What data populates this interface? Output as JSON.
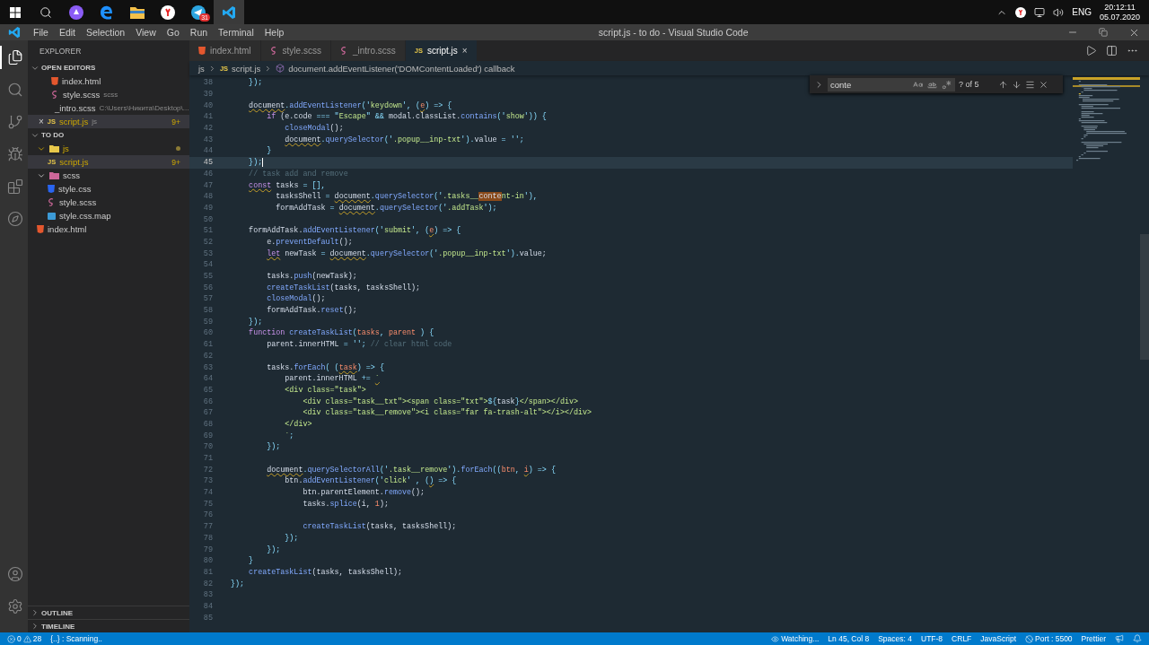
{
  "taskbar": {
    "apps": [
      {
        "kind": "start",
        "selected": false
      },
      {
        "kind": "search",
        "selected": false
      },
      {
        "kind": "assistant",
        "selected": false
      },
      {
        "kind": "edge",
        "selected": false
      },
      {
        "kind": "explorer",
        "selected": false
      },
      {
        "kind": "yandex",
        "selected": false
      },
      {
        "kind": "telegram",
        "selected": false,
        "badge": "31"
      },
      {
        "kind": "vscode",
        "selected": true
      }
    ],
    "tray": {
      "icons": [
        {
          "kind": "chevron"
        },
        {
          "kind": "yandex"
        },
        {
          "kind": "network"
        },
        {
          "kind": "volume"
        }
      ],
      "language": "ENG",
      "time": "20:12:11",
      "date": "05.07.2020"
    }
  },
  "window": {
    "menu": [
      "File",
      "Edit",
      "Selection",
      "View",
      "Go",
      "Run",
      "Terminal",
      "Help"
    ],
    "title": "script.js - to do - Visual Studio Code"
  },
  "activity_bar": {
    "top": [
      {
        "kind": "explorer",
        "selected": true
      },
      {
        "kind": "search",
        "selected": false
      },
      {
        "kind": "scm",
        "selected": false
      },
      {
        "kind": "debug",
        "selected": false
      },
      {
        "kind": "extensions",
        "selected": false
      },
      {
        "kind": "remote",
        "selected": false
      }
    ],
    "bottom": [
      {
        "kind": "account"
      },
      {
        "kind": "settings"
      }
    ]
  },
  "sidebar": {
    "title": "EXPLORER",
    "open_editors": {
      "title": "OPEN EDITORS",
      "expanded": true,
      "items": [
        {
          "name": "index.html",
          "kind": "html",
          "selected": false,
          "warning": false
        },
        {
          "name": "style.scss",
          "kind": "scss",
          "description": "scss",
          "selected": false,
          "warning": false
        },
        {
          "name": "_intro.scss",
          "kind": "scss",
          "description": "C:\\Users\\Никита\\Desktop\\...",
          "selected": false,
          "warning": false
        },
        {
          "name": "script.js",
          "kind": "js",
          "icon_text": "JS",
          "description": "js",
          "badge": "9+",
          "close": "×",
          "selected": true,
          "warning": true
        }
      ]
    },
    "project": {
      "title": "TO DO",
      "expanded": true,
      "tree": [
        {
          "name": "js",
          "kind": "folder-js",
          "expanded": true,
          "modified": true,
          "warning": true,
          "selected": false,
          "children": [
            {
              "name": "script.js",
              "kind": "js",
              "icon_text": "JS",
              "badge": "9+",
              "selected": true,
              "warning": true
            }
          ]
        },
        {
          "name": "scss",
          "kind": "folder-scss",
          "expanded": true,
          "modified": false,
          "warning": false,
          "selected": false,
          "children": [
            {
              "name": "style.css",
              "kind": "css",
              "selected": false,
              "warning": false
            },
            {
              "name": "style.scss",
              "kind": "scss",
              "selected": false,
              "warning": false
            },
            {
              "name": "style.css.map",
              "kind": "map",
              "selected": false,
              "warning": false
            }
          ]
        },
        {
          "name": "index.html",
          "kind": "html",
          "selected": false,
          "warning": false
        }
      ]
    },
    "collapsed_sections": [
      {
        "title": "OUTLINE",
        "expanded": false
      },
      {
        "title": "TIMELINE",
        "expanded": false
      }
    ]
  },
  "tabs": [
    {
      "name": "index.html",
      "kind": "html",
      "selected": false
    },
    {
      "name": "style.scss",
      "kind": "scss",
      "selected": false
    },
    {
      "name": "_intro.scss",
      "kind": "scss",
      "selected": false
    },
    {
      "name": "script.js",
      "kind": "js",
      "icon_text": "JS",
      "selected": true,
      "close": "×"
    }
  ],
  "breadcrumbs": [
    {
      "kind": "folder",
      "text": "js"
    },
    {
      "kind": "js",
      "icon_text": "JS",
      "text": "script.js"
    },
    {
      "kind": "symbol",
      "text": "document.addEventListener('DOMContentLoaded') callback"
    }
  ],
  "find_widget": {
    "query": "conte",
    "count": "? of 5",
    "match_case": false,
    "whole_word": false,
    "regex": false
  },
  "editor": {
    "lines": [
      {
        "number": "38",
        "current": false,
        "tokens": [
          {
            "kind": "punct",
            "text": "    });"
          }
        ]
      },
      {
        "number": "39",
        "current": false
      },
      {
        "number": "40",
        "current": false,
        "tokens": [
          {
            "kind": "plain",
            "text": "    document",
            "squiggle": true
          },
          {
            "kind": "punct",
            "text": "."
          },
          {
            "kind": "function",
            "text": "addEventListener"
          },
          {
            "kind": "punct",
            "text": "('"
          },
          {
            "kind": "string",
            "text": "keydown"
          },
          {
            "kind": "punct",
            "text": "', ("
          },
          {
            "kind": "param",
            "text": "e",
            "squiggle": true
          },
          {
            "kind": "punct",
            "text": ") => {"
          }
        ]
      },
      {
        "number": "41",
        "current": false,
        "tokens": [
          {
            "kind": "keyword",
            "text": "        if"
          },
          {
            "kind": "plain",
            "text": " (e.code "
          },
          {
            "kind": "punct",
            "text": "=== \""
          },
          {
            "kind": "string",
            "text": "Escape"
          },
          {
            "kind": "punct",
            "text": "\" && "
          },
          {
            "kind": "plain",
            "text": "modal.classList."
          },
          {
            "kind": "function",
            "text": "contains"
          },
          {
            "kind": "punct",
            "text": "('"
          },
          {
            "kind": "string",
            "text": "show"
          },
          {
            "kind": "punct",
            "text": "')) {"
          }
        ]
      },
      {
        "number": "42",
        "current": false,
        "tokens": [
          {
            "kind": "function",
            "text": "            closeModal"
          },
          {
            "kind": "plain",
            "text": "();"
          }
        ]
      },
      {
        "number": "43",
        "current": false,
        "tokens": [
          {
            "kind": "plain",
            "text": "            document",
            "squiggle": true
          },
          {
            "kind": "punct",
            "text": "."
          },
          {
            "kind": "function",
            "text": "querySelector"
          },
          {
            "kind": "punct",
            "text": "('"
          },
          {
            "kind": "string",
            "text": ".popup__inp-txt"
          },
          {
            "kind": "punct",
            "text": "')."
          },
          {
            "kind": "plain",
            "text": "value "
          },
          {
            "kind": "punct",
            "text": "= '';"
          }
        ]
      },
      {
        "number": "44",
        "current": false,
        "tokens": [
          {
            "kind": "punct",
            "text": "        }"
          }
        ]
      },
      {
        "number": "45",
        "current": true,
        "tokens": [
          {
            "kind": "punct",
            "text": "    });"
          }
        ]
      },
      {
        "number": "46",
        "current": false,
        "tokens": [
          {
            "kind": "comment",
            "text": "    // task add and remove"
          }
        ]
      },
      {
        "number": "47",
        "current": false,
        "tokens": [
          {
            "kind": "keyword",
            "text": "    const",
            "squiggle": true
          },
          {
            "kind": "plain",
            "text": " tasks "
          },
          {
            "kind": "punct",
            "text": "= [],"
          }
        ]
      },
      {
        "number": "48",
        "current": false,
        "tokens": [
          {
            "kind": "plain",
            "text": "          tasksShell "
          },
          {
            "kind": "punct",
            "text": "= "
          },
          {
            "kind": "plain",
            "text": "document",
            "squiggle": true
          },
          {
            "kind": "punct",
            "text": "."
          },
          {
            "kind": "function",
            "text": "querySelector"
          },
          {
            "kind": "punct",
            "text": "('"
          },
          {
            "kind": "string",
            "text": ".tasks__"
          },
          {
            "kind": "match",
            "text": "conte"
          },
          {
            "kind": "string",
            "text": "nt-in"
          },
          {
            "kind": "punct",
            "text": "'),"
          }
        ]
      },
      {
        "number": "49",
        "current": false,
        "tokens": [
          {
            "kind": "plain",
            "text": "          formAddTask "
          },
          {
            "kind": "punct",
            "text": "= "
          },
          {
            "kind": "plain",
            "text": "document",
            "squiggle": true
          },
          {
            "kind": "punct",
            "text": "."
          },
          {
            "kind": "function",
            "text": "querySelector"
          },
          {
            "kind": "punct",
            "text": "('"
          },
          {
            "kind": "string",
            "text": ".addTask"
          },
          {
            "kind": "punct",
            "text": "');"
          }
        ]
      },
      {
        "number": "50",
        "current": false
      },
      {
        "number": "51",
        "current": false,
        "tokens": [
          {
            "kind": "plain",
            "text": "    formAddTask."
          },
          {
            "kind": "function",
            "text": "addEventListener"
          },
          {
            "kind": "punct",
            "text": "('"
          },
          {
            "kind": "string",
            "text": "submit"
          },
          {
            "kind": "punct",
            "text": "', ("
          },
          {
            "kind": "param",
            "text": "e",
            "squiggle": true
          },
          {
            "kind": "punct",
            "text": ") => {"
          }
        ]
      },
      {
        "number": "52",
        "current": false,
        "tokens": [
          {
            "kind": "plain",
            "text": "        e."
          },
          {
            "kind": "function",
            "text": "preventDefault"
          },
          {
            "kind": "plain",
            "text": "();"
          }
        ]
      },
      {
        "number": "53",
        "current": false,
        "tokens": [
          {
            "kind": "keyword",
            "text": "        let",
            "squiggle": true
          },
          {
            "kind": "plain",
            "text": " newTask "
          },
          {
            "kind": "punct",
            "text": "= "
          },
          {
            "kind": "plain",
            "text": "document",
            "squiggle": true
          },
          {
            "kind": "punct",
            "text": "."
          },
          {
            "kind": "function",
            "text": "querySelector"
          },
          {
            "kind": "punct",
            "text": "('"
          },
          {
            "kind": "string",
            "text": ".popup__inp-txt"
          },
          {
            "kind": "punct",
            "text": "')."
          },
          {
            "kind": "plain",
            "text": "value;"
          }
        ]
      },
      {
        "number": "54",
        "current": false
      },
      {
        "number": "55",
        "current": false,
        "tokens": [
          {
            "kind": "plain",
            "text": "        tasks."
          },
          {
            "kind": "function",
            "text": "push"
          },
          {
            "kind": "plain",
            "text": "(newTask);"
          }
        ]
      },
      {
        "number": "56",
        "current": false,
        "tokens": [
          {
            "kind": "function",
            "text": "        createTaskList"
          },
          {
            "kind": "plain",
            "text": "(tasks, tasksShell);"
          }
        ]
      },
      {
        "number": "57",
        "current": false,
        "tokens": [
          {
            "kind": "function",
            "text": "        closeModal"
          },
          {
            "kind": "plain",
            "text": "();"
          }
        ]
      },
      {
        "number": "58",
        "current": false,
        "tokens": [
          {
            "kind": "plain",
            "text": "        formAddTask."
          },
          {
            "kind": "function",
            "text": "reset"
          },
          {
            "kind": "plain",
            "text": "();"
          }
        ]
      },
      {
        "number": "59",
        "current": false,
        "tokens": [
          {
            "kind": "punct",
            "text": "    });"
          }
        ]
      },
      {
        "number": "60",
        "current": false,
        "tokens": [
          {
            "kind": "keyword",
            "text": "    function"
          },
          {
            "kind": "function",
            "text": " createTaskList"
          },
          {
            "kind": "punct",
            "text": "("
          },
          {
            "kind": "param",
            "text": "tasks"
          },
          {
            "kind": "punct",
            "text": ", "
          },
          {
            "kind": "param",
            "text": "parent"
          },
          {
            "kind": "punct",
            "text": " ) {"
          }
        ]
      },
      {
        "number": "61",
        "current": false,
        "tokens": [
          {
            "kind": "plain",
            "text": "        parent.innerHTML "
          },
          {
            "kind": "punct",
            "text": "= ''; "
          },
          {
            "kind": "comment",
            "text": "// clear html code"
          }
        ]
      },
      {
        "number": "62",
        "current": false
      },
      {
        "number": "63",
        "current": false,
        "tokens": [
          {
            "kind": "plain",
            "text": "        tasks."
          },
          {
            "kind": "function",
            "text": "forEach"
          },
          {
            "kind": "punct",
            "text": "( ("
          },
          {
            "kind": "param",
            "text": "task",
            "squiggle": true
          },
          {
            "kind": "punct",
            "text": ") => {"
          }
        ]
      },
      {
        "number": "64",
        "current": false,
        "tokens": [
          {
            "kind": "plain",
            "text": "            parent.innerHTML "
          },
          {
            "kind": "punct",
            "text": "+= "
          },
          {
            "kind": "string",
            "text": "`",
            "squiggle": true
          }
        ]
      },
      {
        "number": "65",
        "current": false,
        "tokens": [
          {
            "kind": "string",
            "text": "            <div class=\"task\">"
          }
        ]
      },
      {
        "number": "66",
        "current": false,
        "tokens": [
          {
            "kind": "string",
            "text": "                <div class=\"task__txt\"><span class=\"txt\">"
          },
          {
            "kind": "punct",
            "text": "${"
          },
          {
            "kind": "plain",
            "text": "task"
          },
          {
            "kind": "punct",
            "text": "}"
          },
          {
            "kind": "string",
            "text": "</span></div>"
          }
        ]
      },
      {
        "number": "67",
        "current": false,
        "tokens": [
          {
            "kind": "string",
            "text": "                <div class=\"task__remove\"><i class=\"far fa-trash-alt\"></i></div>"
          }
        ]
      },
      {
        "number": "68",
        "current": false,
        "tokens": [
          {
            "kind": "string",
            "text": "            </div>"
          }
        ]
      },
      {
        "number": "69",
        "current": false,
        "tokens": [
          {
            "kind": "string",
            "text": "            `"
          },
          {
            "kind": "punct",
            "text": ";"
          }
        ]
      },
      {
        "number": "70",
        "current": false,
        "tokens": [
          {
            "kind": "punct",
            "text": "        });"
          }
        ]
      },
      {
        "number": "71",
        "current": false
      },
      {
        "number": "72",
        "current": false,
        "tokens": [
          {
            "kind": "plain",
            "text": "        document",
            "squiggle": true
          },
          {
            "kind": "punct",
            "text": "."
          },
          {
            "kind": "function",
            "text": "querySelectorAll"
          },
          {
            "kind": "punct",
            "text": "('"
          },
          {
            "kind": "string",
            "text": ".task__remove"
          },
          {
            "kind": "punct",
            "text": "')."
          },
          {
            "kind": "function",
            "text": "forEach"
          },
          {
            "kind": "punct",
            "text": "(("
          },
          {
            "kind": "param",
            "text": "btn"
          },
          {
            "kind": "punct",
            "text": ", "
          },
          {
            "kind": "param",
            "text": "i",
            "squiggle": true
          },
          {
            "kind": "punct",
            "text": ") => {"
          }
        ]
      },
      {
        "number": "73",
        "current": false,
        "tokens": [
          {
            "kind": "plain",
            "text": "            btn."
          },
          {
            "kind": "function",
            "text": "addEventListener"
          },
          {
            "kind": "punct",
            "text": "('"
          },
          {
            "kind": "string",
            "text": "click"
          },
          {
            "kind": "punct",
            "text": "' , ("
          },
          {
            "kind": "punct",
            "text": ")",
            "squiggle": true
          },
          {
            "kind": "punct",
            "text": " => {"
          }
        ]
      },
      {
        "number": "74",
        "current": false,
        "tokens": [
          {
            "kind": "plain",
            "text": "                btn.parentElement."
          },
          {
            "kind": "function",
            "text": "remove"
          },
          {
            "kind": "plain",
            "text": "();"
          }
        ]
      },
      {
        "number": "75",
        "current": false,
        "tokens": [
          {
            "kind": "plain",
            "text": "                tasks."
          },
          {
            "kind": "function",
            "text": "splice"
          },
          {
            "kind": "plain",
            "text": "(i, "
          },
          {
            "kind": "number",
            "text": "1"
          },
          {
            "kind": "plain",
            "text": ");"
          }
        ]
      },
      {
        "number": "76",
        "current": false
      },
      {
        "number": "77",
        "current": false,
        "tokens": [
          {
            "kind": "function",
            "text": "                createTaskList"
          },
          {
            "kind": "plain",
            "text": "(tasks, tasksShell);"
          }
        ]
      },
      {
        "number": "78",
        "current": false,
        "tokens": [
          {
            "kind": "punct",
            "text": "            });"
          }
        ]
      },
      {
        "number": "79",
        "current": false,
        "tokens": [
          {
            "kind": "punct",
            "text": "        });"
          }
        ]
      },
      {
        "number": "80",
        "current": false,
        "tokens": [
          {
            "kind": "punct",
            "text": "    }"
          }
        ]
      },
      {
        "number": "81",
        "current": false,
        "tokens": [
          {
            "kind": "function",
            "text": "    createTaskList"
          },
          {
            "kind": "plain",
            "text": "(tasks, tasksShell);"
          }
        ]
      },
      {
        "number": "82",
        "current": false,
        "tokens": [
          {
            "kind": "punct",
            "text": "});"
          }
        ]
      },
      {
        "number": "83",
        "current": false
      },
      {
        "number": "84",
        "current": false
      },
      {
        "number": "85",
        "current": false
      }
    ]
  },
  "status_bar": {
    "errors": "0",
    "warnings": "28",
    "left": [
      {
        "kind": "text",
        "text": "{..} : Scanning.."
      }
    ],
    "right": [
      {
        "kind": "watch",
        "text": "Watching..."
      },
      {
        "kind": "text",
        "text": "Ln 45, Col 8"
      },
      {
        "kind": "text",
        "text": "Spaces: 4"
      },
      {
        "kind": "text",
        "text": "UTF-8"
      },
      {
        "kind": "text",
        "text": "CRLF"
      },
      {
        "kind": "text",
        "text": "JavaScript"
      },
      {
        "kind": "port",
        "text": "Port : 5500"
      },
      {
        "kind": "text",
        "text": "Prettier"
      },
      {
        "kind": "feedback"
      },
      {
        "kind": "bell"
      }
    ]
  }
}
